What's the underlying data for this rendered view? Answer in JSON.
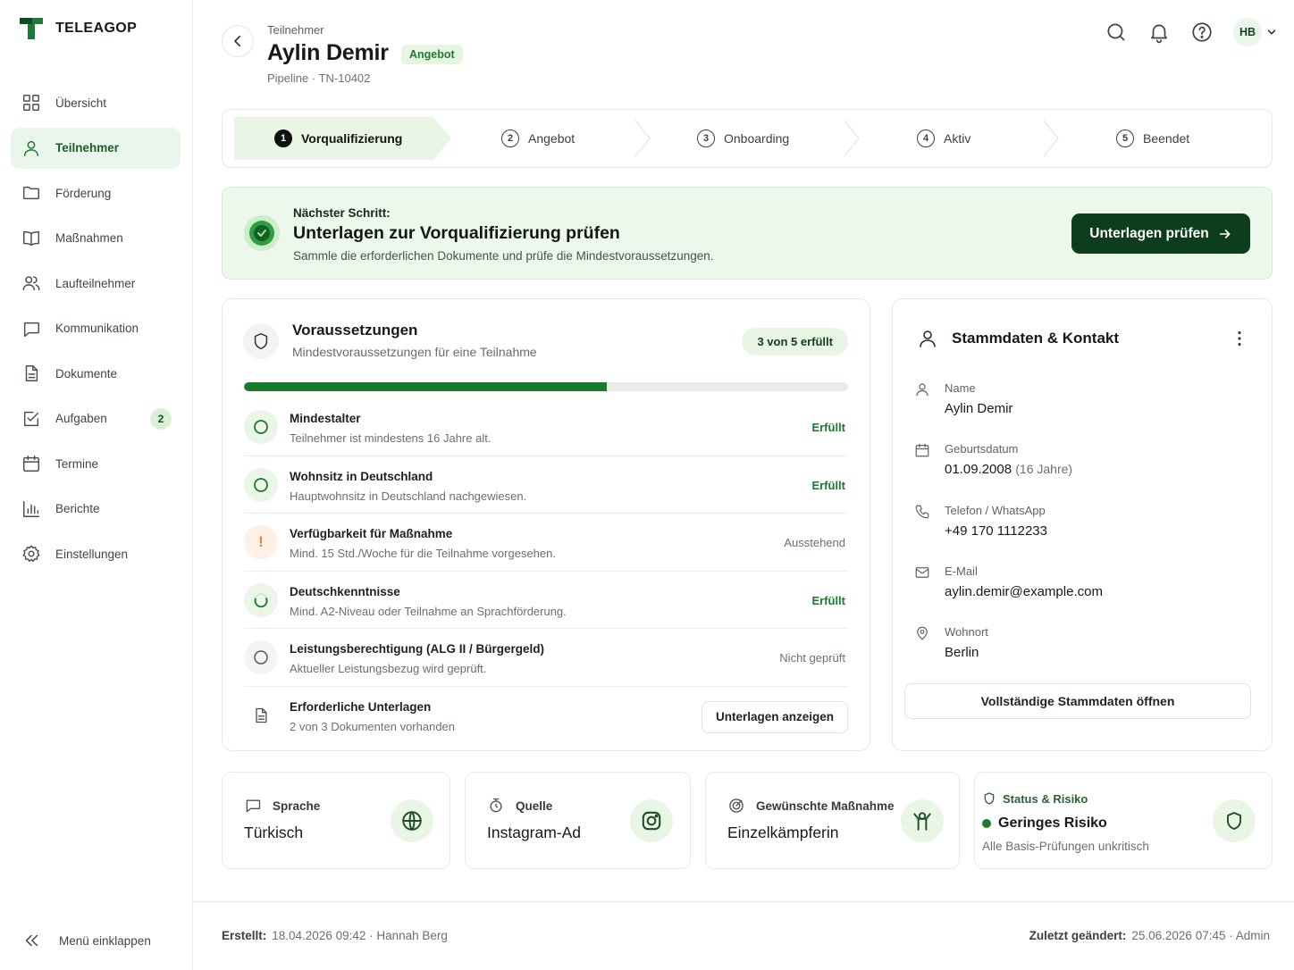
{
  "app": {
    "brand": "TELEAGOP"
  },
  "sidebar": {
    "items": [
      {
        "label": "Übersicht"
      },
      {
        "label": "Teilnehmer"
      },
      {
        "label": "Förderung"
      },
      {
        "label": "Maßnahmen"
      },
      {
        "label": "Laufteilnehmer"
      },
      {
        "label": "Kommunikation"
      },
      {
        "label": "Dokumente"
      },
      {
        "label": "Aufgaben",
        "badge": "2"
      },
      {
        "label": "Termine"
      },
      {
        "label": "Berichte"
      },
      {
        "label": "Einstellungen"
      }
    ],
    "active_index": 1,
    "collapse_label": "Menü einklappen"
  },
  "header": {
    "kicker": "Teilnehmer",
    "title": "Aylin Demir",
    "badge": "Angebot",
    "subtitle": "Pipeline · TN-10402",
    "user_initials": "HB"
  },
  "stepper": {
    "steps": [
      {
        "number": "1",
        "label": "Vorqualifizierung"
      },
      {
        "number": "2",
        "label": "Angebot"
      },
      {
        "number": "3",
        "label": "Onboarding"
      },
      {
        "number": "4",
        "label": "Aktiv"
      },
      {
        "number": "5",
        "label": "Beendet"
      }
    ],
    "active_index": 0
  },
  "next_step": {
    "kicker": "Nächster Schritt:",
    "title": "Unterlagen zur Vorqualifizierung prüfen",
    "description": "Sammle die erforderlichen Dokumente und prüfe die Mindestvoraussetzungen.",
    "button_label": "Unterlagen prüfen"
  },
  "requirements": {
    "title": "Voraussetzungen",
    "subtitle": "Mindestvoraussetzungen für eine Teilnahme",
    "count_label": "3 von 5 erfüllt",
    "progress_percent": 60,
    "items": [
      {
        "name": "Mindestalter",
        "description": "Teilnehmer ist mindestens 16 Jahre alt.",
        "status": "Erfüllt"
      },
      {
        "name": "Wohnsitz in Deutschland",
        "description": "Hauptwohnsitz in Deutschland nachgewiesen.",
        "status": "Erfüllt"
      },
      {
        "name": "Verfügbarkeit für Maßnahme",
        "description": "Mind. 15 Std./Woche für die Teilnahme vorgesehen.",
        "status": "Ausstehend",
        "icon_text": "!"
      },
      {
        "name": "Deutschkenntnisse",
        "description": "Mind. A2-Niveau oder Teilnahme an Sprachförderung.",
        "status": "Erfüllt"
      },
      {
        "name": "Leistungsberechtigung (ALG II / Bürgergeld)",
        "description": "Aktueller Leistungsbezug wird geprüft.",
        "status": "Nicht geprüft"
      }
    ],
    "documents": {
      "name": "Erforderliche Unterlagen",
      "description": "2 von 3 Dokumenten vorhanden",
      "button_label": "Unterlagen anzeigen"
    }
  },
  "master_data": {
    "title": "Stammdaten & Kontakt",
    "fields": [
      {
        "label": "Name",
        "value": "Aylin Demir"
      },
      {
        "label": "Geburtsdatum",
        "value": "01.09.2008",
        "note": "(16 Jahre)"
      },
      {
        "label": "Telefon / WhatsApp",
        "value": "+49 170 1112233"
      },
      {
        "label": "E-Mail",
        "value": "aylin.demir@example.com"
      },
      {
        "label": "Wohnort",
        "value": "Berlin"
      }
    ],
    "button_label": "Vollständige Stammdaten öffnen"
  },
  "info_cards": {
    "language": {
      "label": "Sprache",
      "value": "Türkisch"
    },
    "source": {
      "label": "Quelle",
      "value": "Instagram-Ad"
    },
    "measure": {
      "label": "Gewünschte Maßnahme",
      "value": "Einzelkämpferin"
    },
    "risk": {
      "label": "Status & Risiko",
      "value": "Geringes Risiko",
      "description": "Alle Basis-Prüfungen unkritisch"
    }
  },
  "footer": {
    "created_label": "Erstellt:",
    "created_value": "18.04.2026 09:42 · Hannah Berg",
    "updated_label": "Zuletzt geändert:",
    "updated_value": "25.06.2026 07:45 · Admin"
  },
  "colors": {
    "accent": "#187a2b",
    "dark_button": "#0d3d1c",
    "warning": "#e58a2c",
    "active_bg": "#eaf6ec"
  }
}
